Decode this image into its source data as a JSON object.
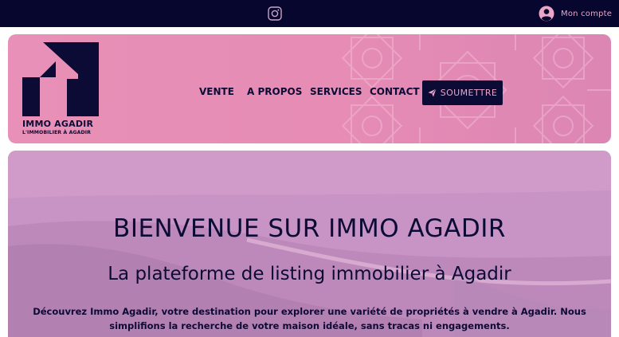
{
  "topbar": {
    "social_icon": "instagram-icon",
    "account_icon": "user-circle-icon",
    "account_label": "Mon compte"
  },
  "brand": {
    "name": "IMMO AGADIR",
    "tagline": "L'IMMOBILIER À AGADIR"
  },
  "nav": {
    "items": [
      {
        "label": "VENTE"
      },
      {
        "label": "A PROPOS"
      },
      {
        "label": "SERVICES"
      },
      {
        "label": "CONTACT"
      }
    ],
    "submit_icon": "paper-plane-icon",
    "submit_label": "SOUMETTRE"
  },
  "hero": {
    "title": "BIENVENUE SUR IMMO AGADIR",
    "subtitle": "La plateforme de listing immobilier à Agadir",
    "description": "Découvrez Immo Agadir, votre destination pour explorer une variété de propriétés à vendre à Agadir. Nous simplifions la recherche de votre maison idéale, sans tracas ni engagements."
  },
  "colors": {
    "navy": "#0c0b35",
    "topbar": "#07062e",
    "pink": "#e890b7",
    "hero_tint": "#cf97c5",
    "soft_pink": "#e9a6c7"
  }
}
